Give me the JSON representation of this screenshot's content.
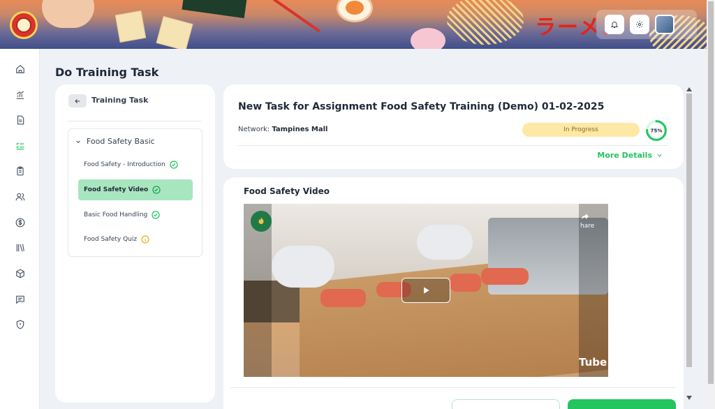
{
  "header": {
    "logo_text": "Ramen",
    "brand_text": "ラーメン",
    "actions": [
      {
        "name": "notifications",
        "icon": "bell-icon"
      },
      {
        "name": "settings",
        "icon": "gear-icon"
      },
      {
        "name": "profile",
        "icon": "avatar"
      }
    ]
  },
  "sidebar": {
    "items": [
      {
        "name": "home",
        "icon": "home-icon"
      },
      {
        "name": "analytics",
        "icon": "chart-icon"
      },
      {
        "name": "documents",
        "icon": "document-icon"
      },
      {
        "name": "tasks",
        "icon": "checklist-icon",
        "active": true
      },
      {
        "name": "clipboard",
        "icon": "clipboard-icon"
      },
      {
        "name": "users",
        "icon": "users-icon"
      },
      {
        "name": "finance",
        "icon": "dollar-icon"
      },
      {
        "name": "library",
        "icon": "books-icon"
      },
      {
        "name": "inventory",
        "icon": "box-icon"
      },
      {
        "name": "messages",
        "icon": "chat-icon"
      },
      {
        "name": "security",
        "icon": "shield-icon"
      }
    ]
  },
  "page": {
    "title": "Do Training Task"
  },
  "training": {
    "heading": "Training Task",
    "module_title": "Food Safety Basic",
    "lessons": [
      {
        "label": "Food Safety - Introduction",
        "status": "complete"
      },
      {
        "label": "Food Safety Video",
        "status": "complete",
        "active": true
      },
      {
        "label": "Basic Food Handling",
        "status": "complete"
      },
      {
        "label": "Food Safety Quiz",
        "status": "pending"
      }
    ]
  },
  "task": {
    "title": "New Task for Assignment Food Safety Training (Demo) 01-02-2025",
    "network_label": "Network:",
    "network_value": "Tampines Mall",
    "status": "In Progress",
    "progress_label": "75%",
    "progress": 0.75,
    "more_details": "More Details"
  },
  "video": {
    "heading": "Food Safety Video",
    "share_label": "hare",
    "platform_label": "Tube"
  },
  "colors": {
    "accent": "#22c55e",
    "active_lesson": "#a8e6c0",
    "status_bg": "#fde8a5",
    "pending": "#eab308"
  }
}
